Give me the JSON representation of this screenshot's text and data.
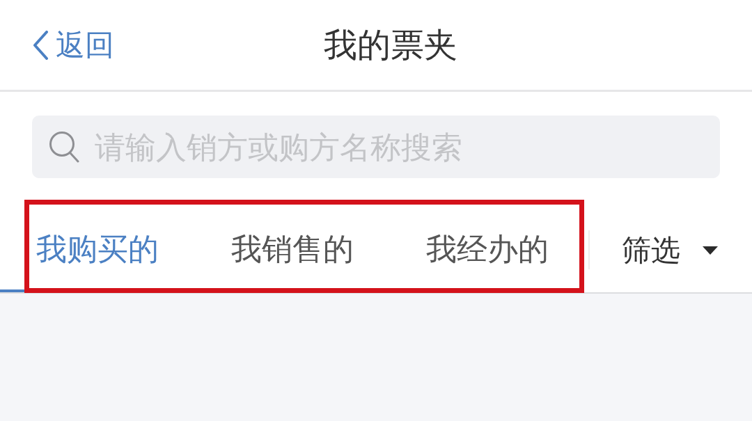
{
  "nav_bar": {
    "back_label": "返回",
    "title": "我的票夹"
  },
  "search": {
    "placeholder": "请输入销方或购方名称搜索"
  },
  "tabs": [
    {
      "label": "我购买的",
      "selected": true
    },
    {
      "label": "我销售的",
      "selected": false
    },
    {
      "label": "我经办的",
      "selected": false
    }
  ],
  "filter": {
    "label": "筛选"
  }
}
